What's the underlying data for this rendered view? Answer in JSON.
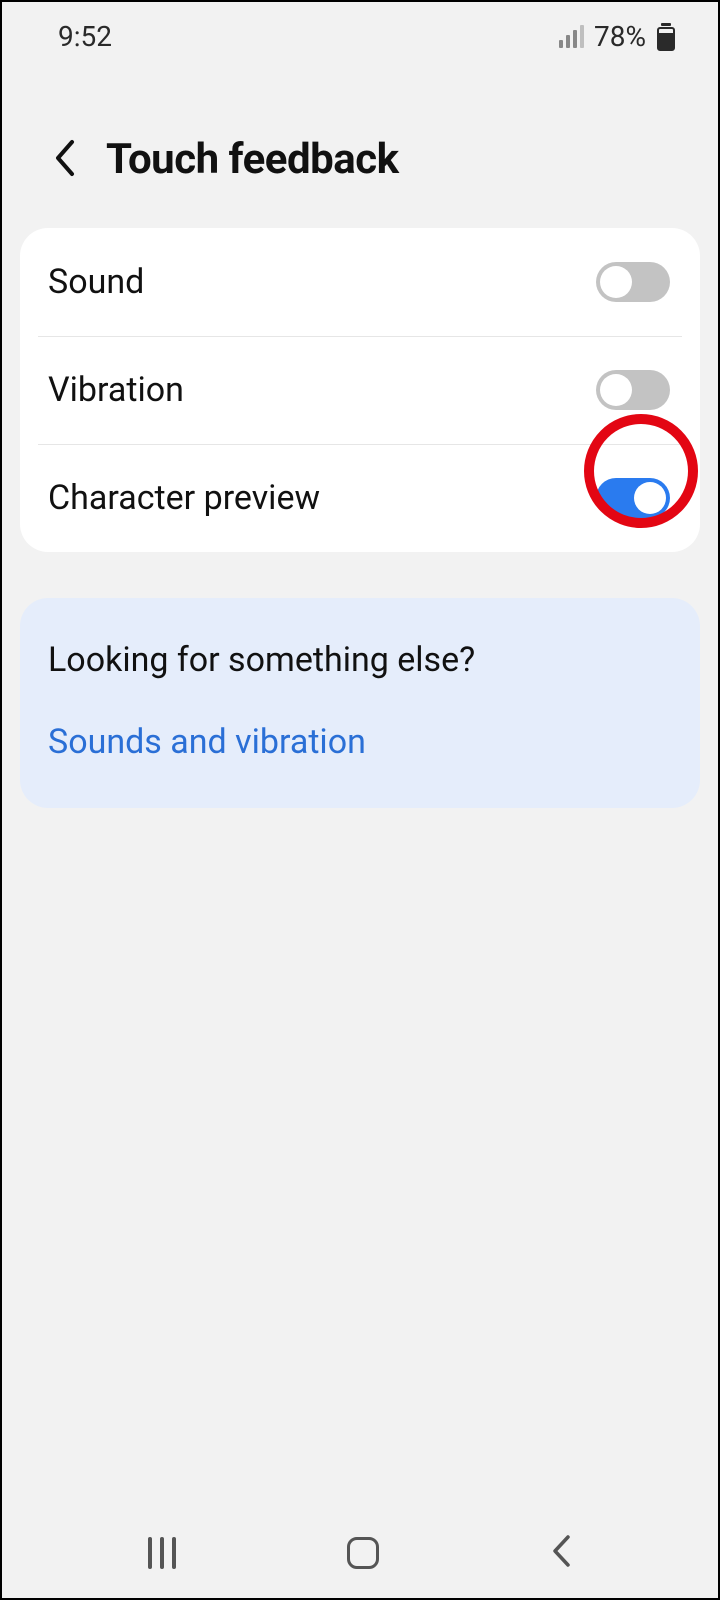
{
  "status": {
    "time": "9:52",
    "battery_pct": "78%"
  },
  "header": {
    "title": "Touch feedback"
  },
  "settings": {
    "sound": {
      "label": "Sound",
      "on": false
    },
    "vibration": {
      "label": "Vibration",
      "on": false
    },
    "preview": {
      "label": "Character preview",
      "on": true
    }
  },
  "more": {
    "title": "Looking for something else?",
    "link": "Sounds and vibration"
  }
}
